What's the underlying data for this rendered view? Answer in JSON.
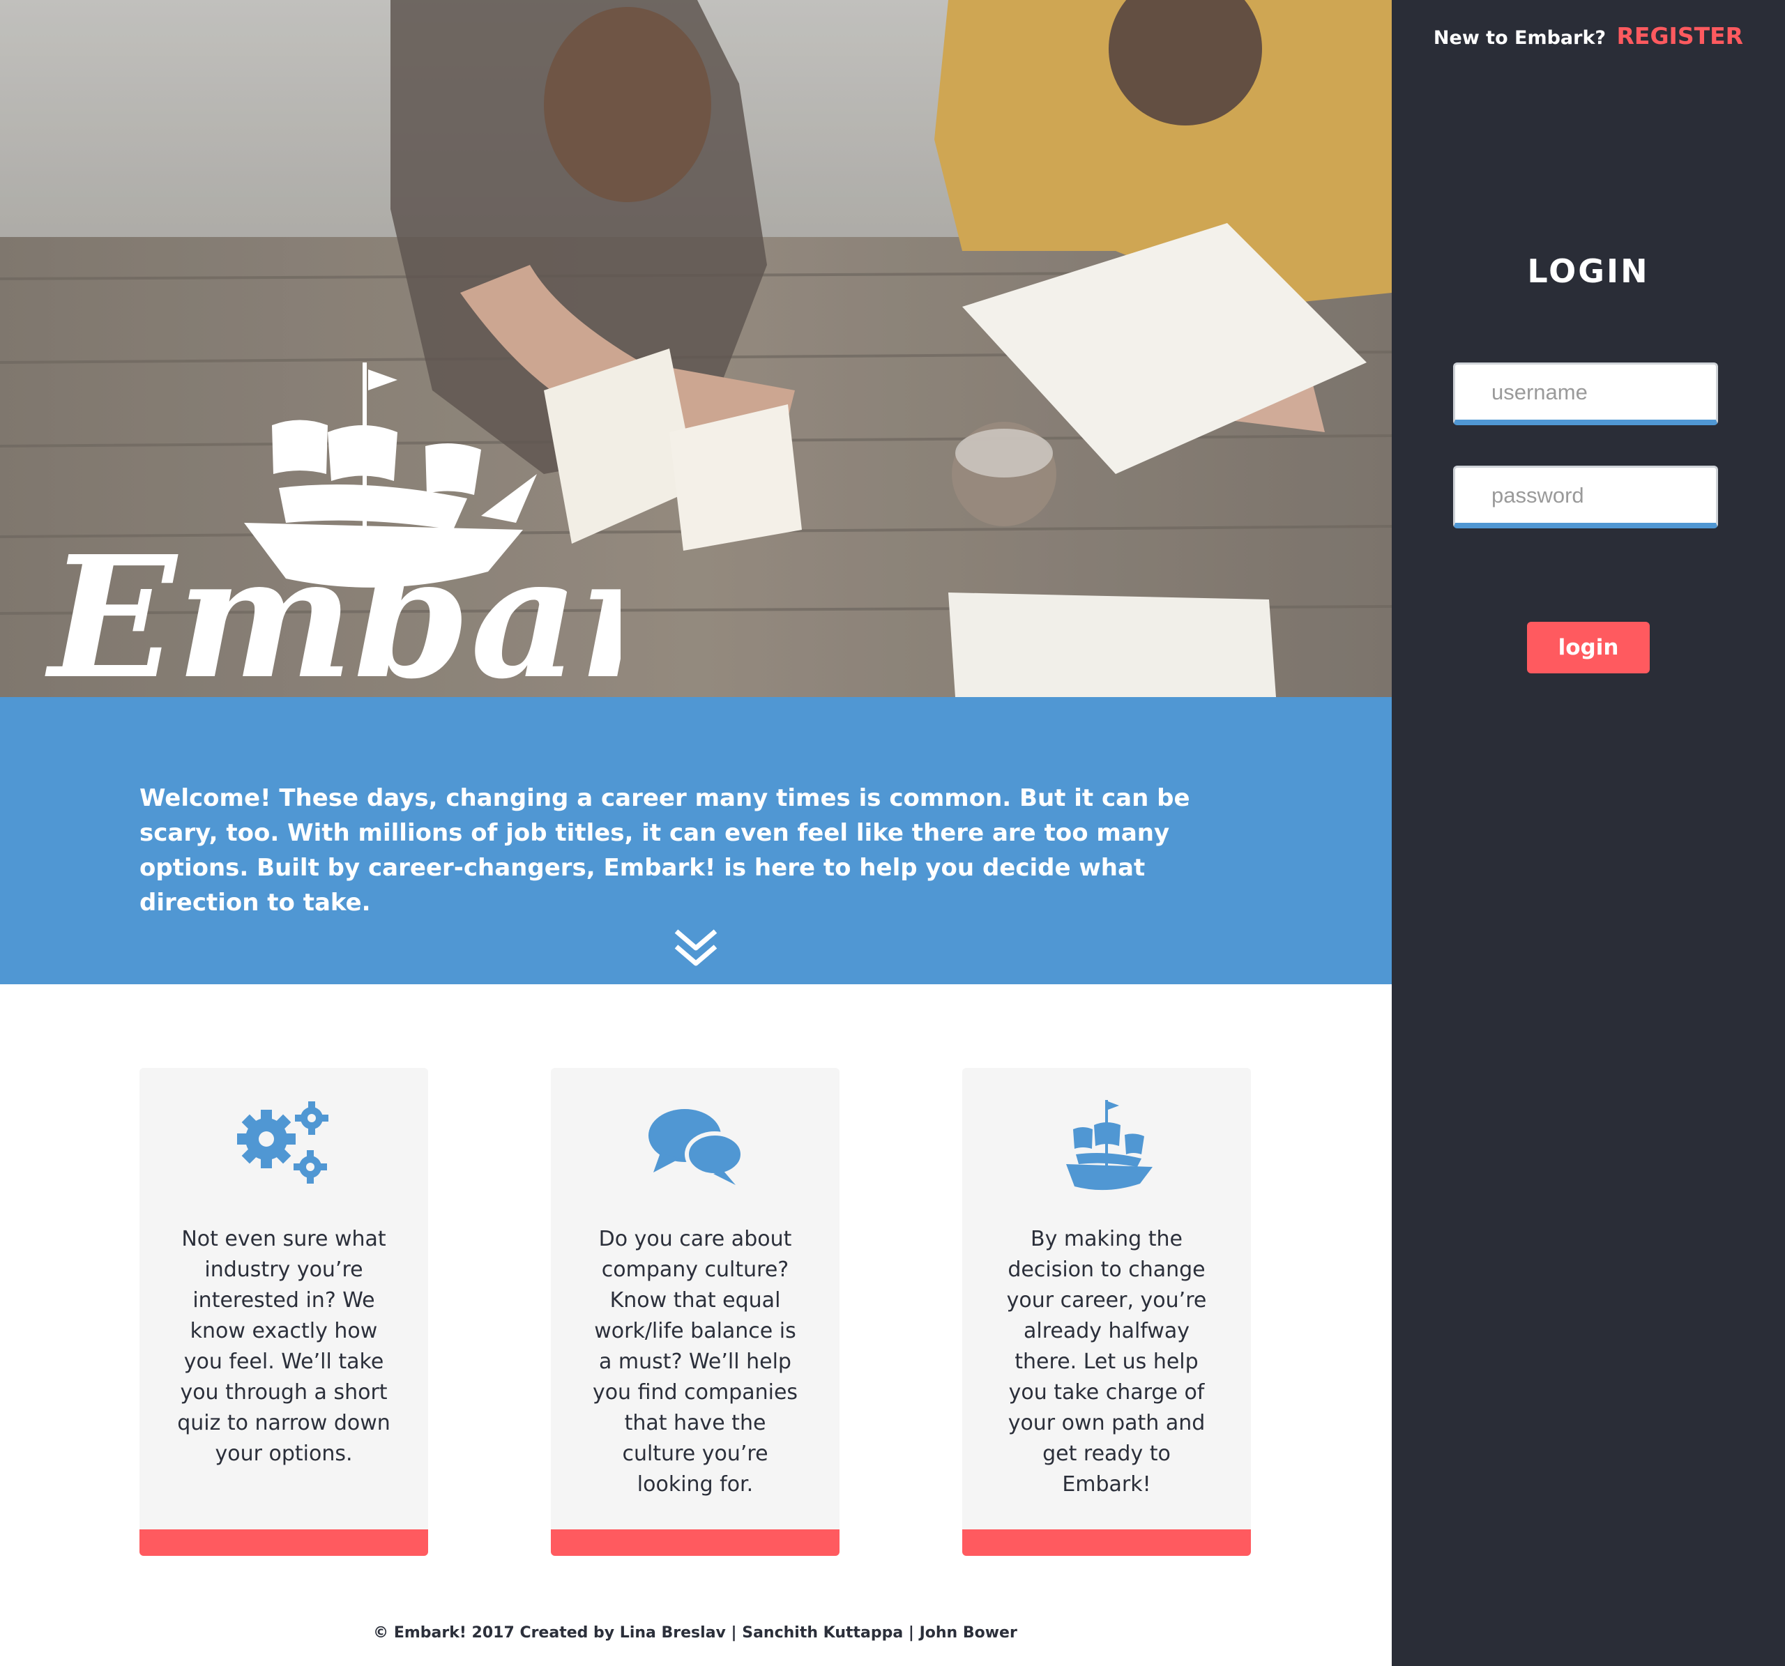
{
  "colors": {
    "accent_blue": "#5097d3",
    "accent_red": "#ff5a5f",
    "panel_dark": "#2a2d37",
    "card_bg": "#f5f5f5"
  },
  "hero": {
    "logo_text": "Embark!",
    "logo_icon": "ship-icon"
  },
  "welcome": {
    "text": "Welcome! These days, changing a career many times is common. But it can be scary, too. With millions of job titles, it can even feel like there are too many options. Built by career-changers, Embark! is here to help you decide what direction to take.",
    "scroll_icon": "double-chevron-down-icon"
  },
  "cards": [
    {
      "icon": "gears-icon",
      "text": "Not even sure what industry you’re interested in? We know exactly how you feel. We’ll take you through a short quiz to narrow down your options."
    },
    {
      "icon": "chat-bubbles-icon",
      "text": "Do you care about company culture? Know that equal work/life balance is a must? We’ll help you find companies that have the culture you’re looking for."
    },
    {
      "icon": "ship-icon",
      "text": "By making the decision to change your career, you’re already halfway there. Let us help you take charge of your own path and get ready to Embark!"
    }
  ],
  "footer": {
    "text": "© Embark! 2017 Created by Lina Breslav | Sanchith Kuttappa | John Bower"
  },
  "sidebar": {
    "register_prompt": "New to Embark?",
    "register_label": "REGISTER",
    "login_title": "LOGIN",
    "username_placeholder": "username",
    "password_placeholder": "password",
    "login_button": "login"
  }
}
